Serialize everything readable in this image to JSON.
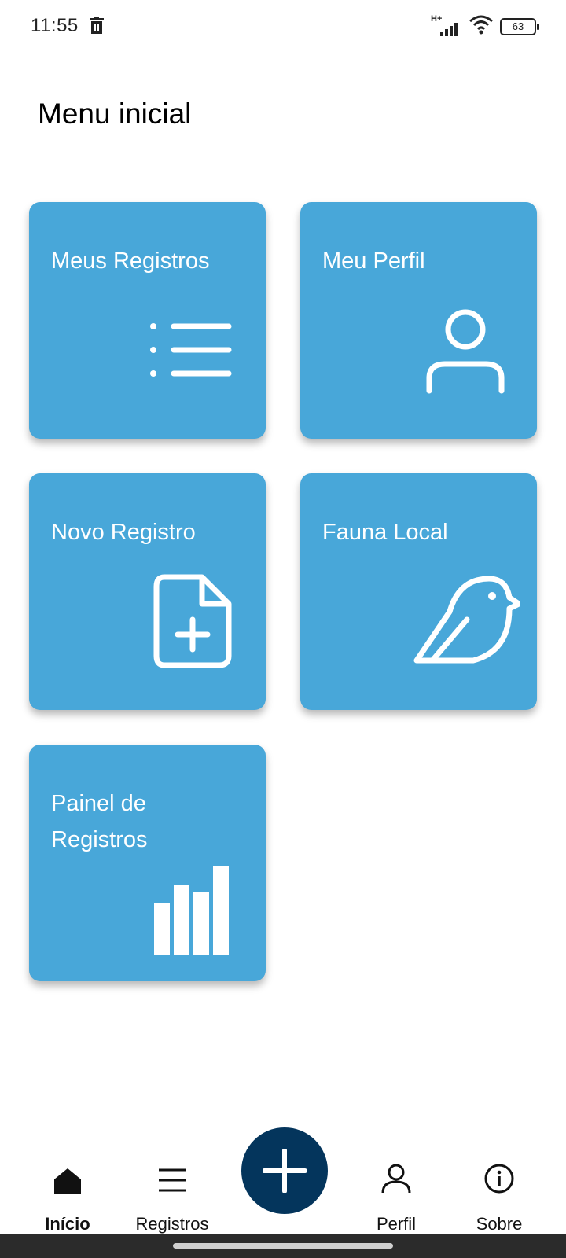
{
  "status_bar": {
    "time": "11:55",
    "network": "H+",
    "battery": "63"
  },
  "page": {
    "title": "Menu inicial"
  },
  "cards": [
    {
      "label": "Meus Registros",
      "icon": "list-icon"
    },
    {
      "label": "Meu Perfil",
      "icon": "person-icon"
    },
    {
      "label": "Novo Registro",
      "icon": "file-plus-icon"
    },
    {
      "label": "Fauna Local",
      "icon": "bird-icon"
    },
    {
      "label": "Painel de Registros",
      "icon": "bar-chart-icon"
    }
  ],
  "bottom_nav": {
    "items": [
      {
        "label": "Início",
        "icon": "home-icon",
        "active": true
      },
      {
        "label": "Registros",
        "icon": "menu-icon"
      },
      {
        "label": "Perfil",
        "icon": "person-icon"
      },
      {
        "label": "Sobre",
        "icon": "info-icon"
      }
    ],
    "fab_icon": "plus-icon"
  },
  "colors": {
    "card": "#48A7D9",
    "fab": "#04355C",
    "text": "#000000"
  }
}
